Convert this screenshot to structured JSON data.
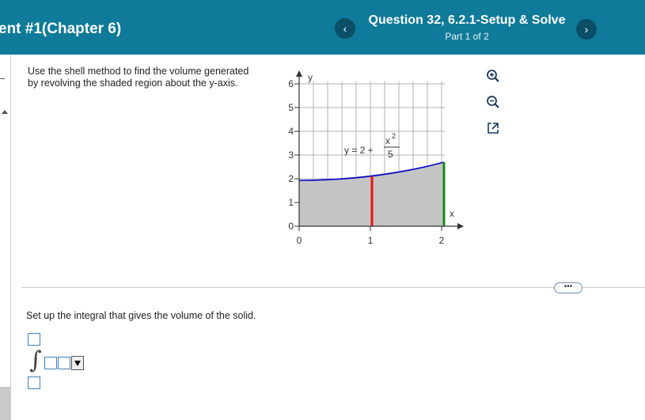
{
  "header": {
    "assignment_title": "ent #1(Chapter 6)",
    "question_title": "Question 32, 6.2.1-Setup & Solve",
    "part": "Part 1 of 2",
    "prev_icon": "‹",
    "next_icon": "›"
  },
  "problem": {
    "line1": "Use the shell method to find the volume generated",
    "line2": "by revolving the shaded region about the y-axis."
  },
  "graph": {
    "y_axis_label": "y",
    "x_axis_label": "x",
    "y_ticks": [
      "0",
      "1",
      "2",
      "3",
      "4",
      "5",
      "6"
    ],
    "x_ticks": [
      "0",
      "1",
      "2"
    ],
    "eq_left": "y = 2 +",
    "eq_num": "x",
    "eq_exp": "2",
    "eq_den": "5",
    "colors": {
      "shade": "#c4c4c4",
      "curve": "#0000cc",
      "red_line": "#ee1111",
      "green_line": "#1a8a1a",
      "grid": "#b0b0b0"
    }
  },
  "tools": {
    "zoom_in_icon": "zoom-in-icon",
    "zoom_out_icon": "zoom-out-icon",
    "popout_icon": "popout-icon"
  },
  "more_button": "•••",
  "setup_text": "Set up the integral that gives the volume of the solid.",
  "integral_symbol": "∫"
}
